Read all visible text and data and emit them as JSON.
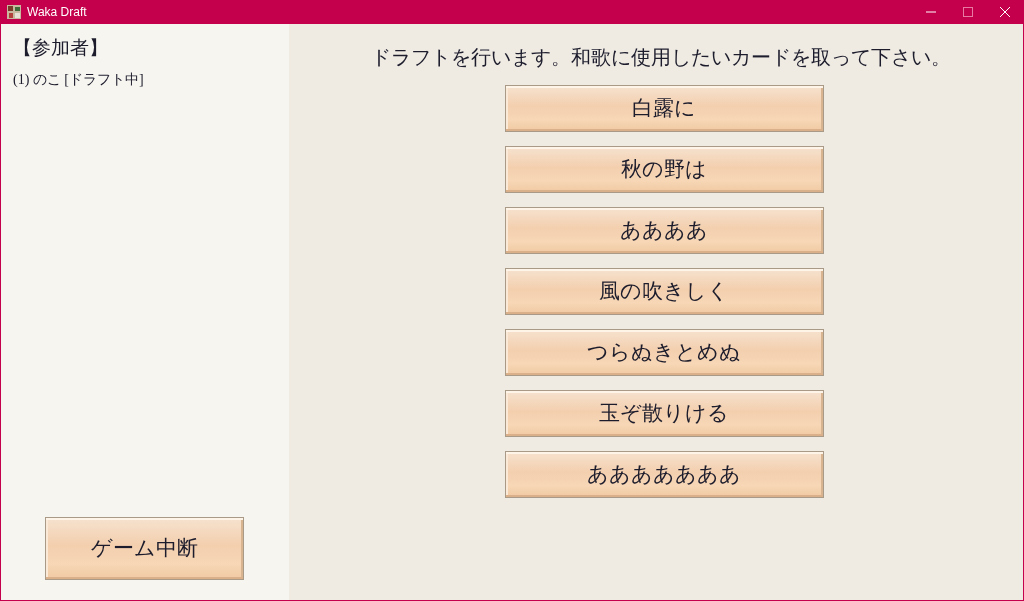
{
  "window": {
    "title": "Waka Draft",
    "maximize_enabled": false
  },
  "participants": {
    "heading": "【参加者】",
    "items": [
      "(1) のこ [ドラフト中]"
    ]
  },
  "instruction": "ドラフトを行います。和歌に使用したいカードを取って下さい。",
  "cards": [
    "白露に",
    "秋の野は",
    "ああああ",
    "風の吹きしく",
    "つらぬきとめぬ",
    "玉ぞ散りける",
    "あああああああ"
  ],
  "abort_button": "ゲーム中断"
}
